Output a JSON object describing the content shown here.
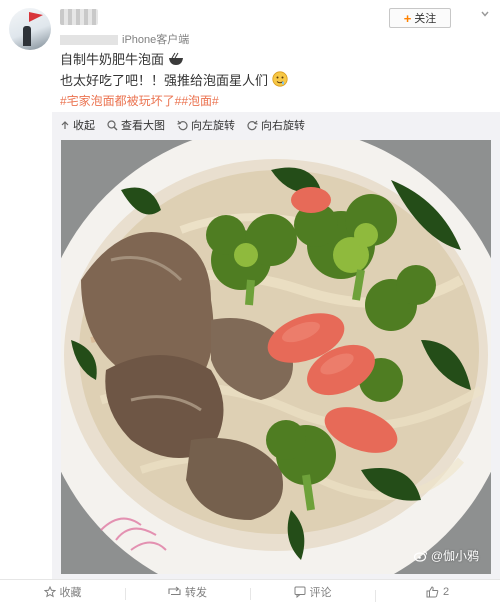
{
  "author": {
    "source": "iPhone客户端"
  },
  "header": {
    "follow_label": "关注"
  },
  "post": {
    "line1": "自制牛奶肥牛泡面",
    "line2": "也太好吃了吧！！强推给泡面星人们",
    "hashtags": "#宅家泡面都被玩坏了##泡面#"
  },
  "media_toolbar": {
    "collapse": "收起",
    "view_large": "查看大图",
    "rotate_left": "向左旋转",
    "rotate_right": "向右旋转"
  },
  "photo": {
    "watermark": "@伽小鸦",
    "icon": "weibo-icon"
  },
  "footer": {
    "favorite": "收藏",
    "repost": "转发",
    "comment": "评论",
    "like_count": "2"
  },
  "colors": {
    "accent_orange": "#ff8200",
    "hashtag": "#eb7350",
    "muted_text": "#808080",
    "media_bg": "#f2f2f5"
  }
}
